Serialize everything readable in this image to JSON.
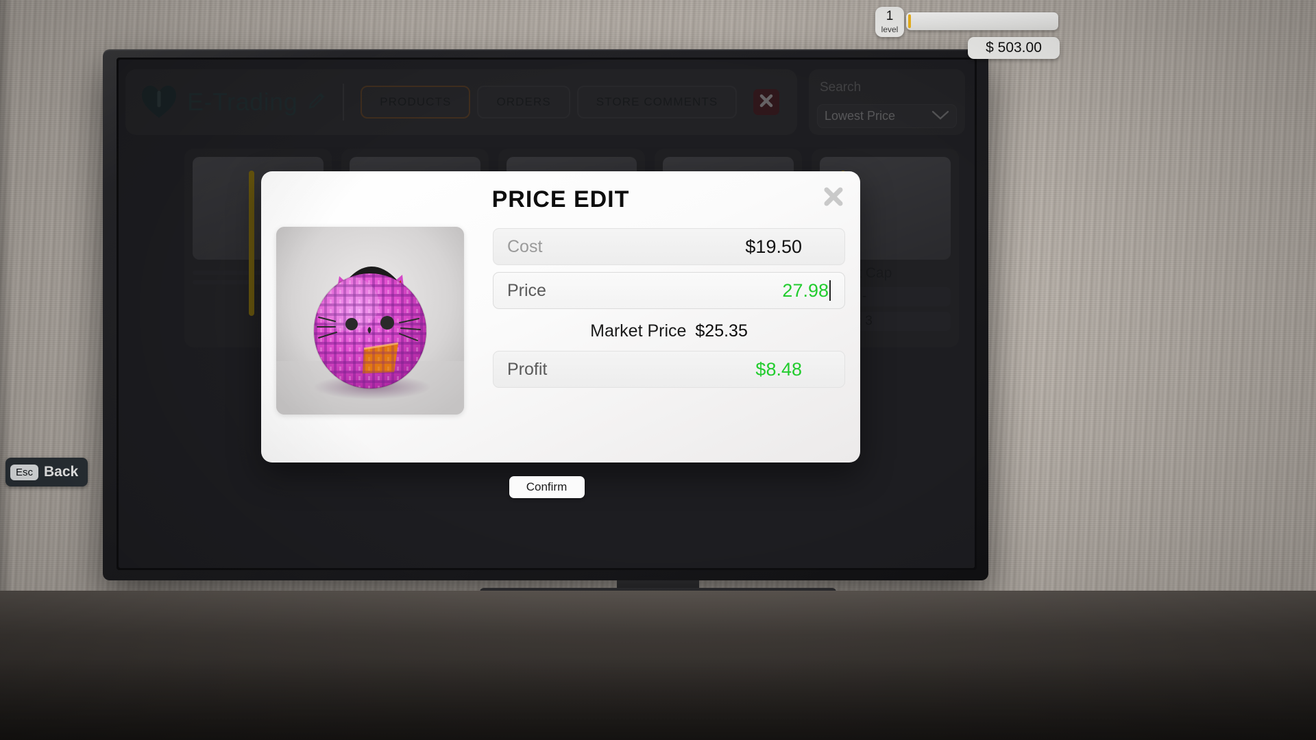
{
  "hud": {
    "level_number": "1",
    "level_caption": "level",
    "xp_percent": 2,
    "money": "$ 503.00",
    "esc_key": "Esc",
    "esc_label": "Back"
  },
  "app": {
    "brand_name": "E-Trading",
    "edit_icon": "pencil-icon",
    "logo_icon": "heart-logo-icon",
    "logo_color": "#2d4a4c",
    "close_icon": "x-close-icon",
    "close_button_color": "#5c1f24",
    "tabs": [
      {
        "label": "PRODUCTS",
        "active": true
      },
      {
        "label": "ORDERS",
        "active": false
      },
      {
        "label": "STORE COMMENTS",
        "active": false
      }
    ],
    "active_tab_border_color": "#8a5a2b",
    "search": {
      "placeholder": "Search",
      "value": ""
    },
    "sort": {
      "selected": "Lowest Price",
      "chevron_icon": "chevron-down-icon"
    }
  },
  "products": [
    {
      "name": "",
      "price": "",
      "stock": ""
    },
    {
      "name": "",
      "price": "",
      "stock": ""
    },
    {
      "name": "",
      "price": "",
      "stock": ""
    },
    {
      "name": "",
      "price": "",
      "stock": ""
    },
    {
      "name": "Rabbit Cap",
      "price": "Price: -",
      "stock": "Stock: 3"
    }
  ],
  "scroll_indicator_color": "#f5c400",
  "modal": {
    "title": "PRICE EDIT",
    "close_icon": "x-close-icon",
    "product_image_alt": "pink-plaid-cat-bag",
    "fields": [
      {
        "label": "Cost",
        "value": "$19.50",
        "editable": false,
        "green": false
      },
      {
        "label": "Price",
        "value": "27.98",
        "editable": true,
        "green": true
      },
      {
        "label": "Profit",
        "value": "$8.48",
        "editable": false,
        "green": true
      }
    ],
    "market_price_label": "Market Price",
    "market_price_value": "$25.35",
    "confirm_label": "Confirm",
    "value_green_color": "#22cc2e"
  }
}
